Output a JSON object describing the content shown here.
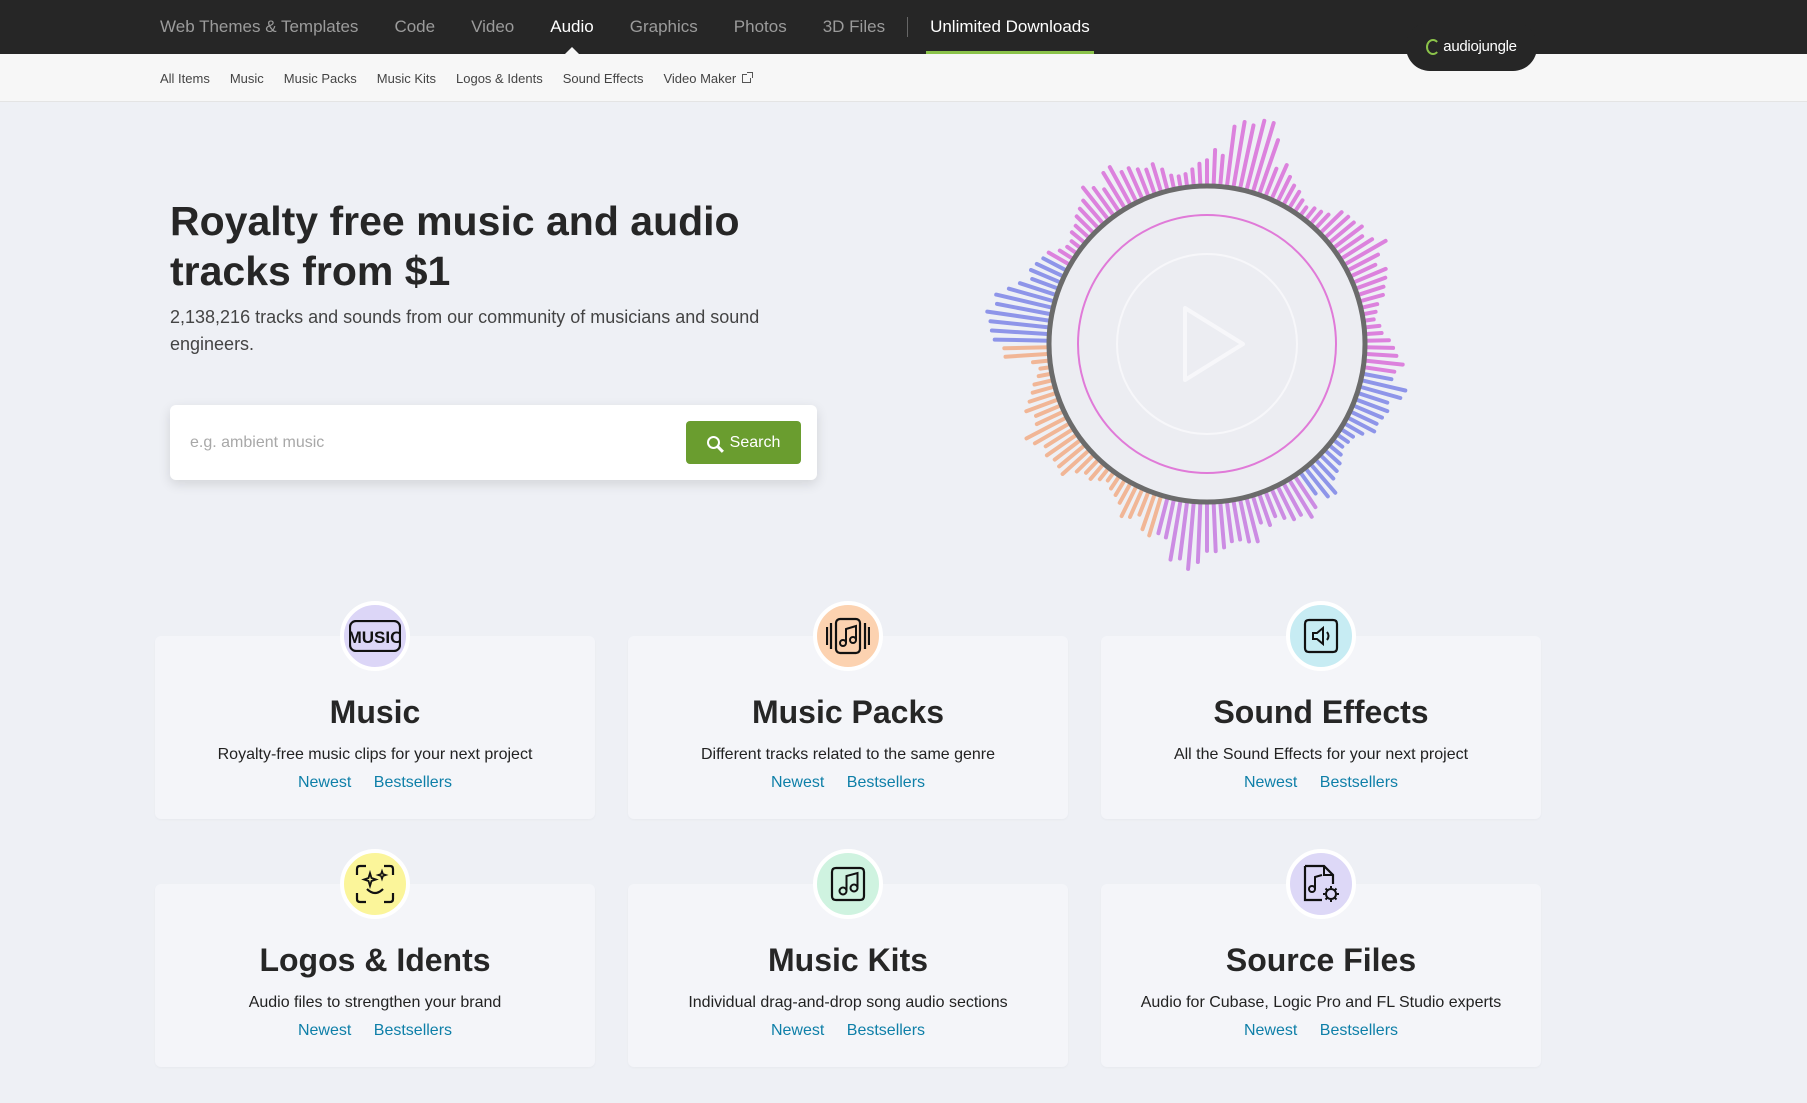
{
  "topnav": {
    "items": [
      {
        "label": "Web Themes & Templates"
      },
      {
        "label": "Code"
      },
      {
        "label": "Video"
      },
      {
        "label": "Audio"
      },
      {
        "label": "Graphics"
      },
      {
        "label": "Photos"
      },
      {
        "label": "3D Files"
      }
    ],
    "unlimited": "Unlimited Downloads",
    "logo": "audiojungle"
  },
  "subnav": {
    "items": [
      {
        "label": "All Items"
      },
      {
        "label": "Music"
      },
      {
        "label": "Music Packs"
      },
      {
        "label": "Music Kits"
      },
      {
        "label": "Logos & Idents"
      },
      {
        "label": "Sound Effects"
      },
      {
        "label": "Video Maker"
      }
    ]
  },
  "hero": {
    "title": "Royalty free music and audio tracks from $1",
    "subtitle": "2,138,216 tracks and sounds from our community of musicians and sound engineers.",
    "search_placeholder": "e.g. ambient music",
    "search_button": "Search"
  },
  "cards": [
    {
      "title": "Music",
      "desc": "Royalty-free music clips for your next project",
      "newest": "Newest",
      "bestsellers": "Bestsellers",
      "icon_bg": "#dcd6f7",
      "icon": "music-text-icon"
    },
    {
      "title": "Music Packs",
      "desc": "Different tracks related to the same genre",
      "newest": "Newest",
      "bestsellers": "Bestsellers",
      "icon_bg": "#fcd2b0",
      "icon": "music-pack-icon"
    },
    {
      "title": "Sound Effects",
      "desc": "All the Sound Effects for your next project",
      "newest": "Newest",
      "bestsellers": "Bestsellers",
      "icon_bg": "#c7ecf3",
      "icon": "speaker-icon"
    },
    {
      "title": "Logos & Idents",
      "desc": "Audio files to strengthen your brand",
      "newest": "Newest",
      "bestsellers": "Bestsellers",
      "icon_bg": "#fbf59a",
      "icon": "sparkle-face-icon"
    },
    {
      "title": "Music Kits",
      "desc": "Individual drag-and-drop song audio sections",
      "newest": "Newest",
      "bestsellers": "Bestsellers",
      "icon_bg": "#cff3e0",
      "icon": "music-note-icon"
    },
    {
      "title": "Source Files",
      "desc": "Audio for Cubase, Logic Pro and FL Studio experts",
      "newest": "Newest",
      "bestsellers": "Bestsellers",
      "icon_bg": "#ddd8f7",
      "icon": "file-gear-icon"
    }
  ],
  "colors": {
    "accent_green": "#6a9d2f",
    "link_blue": "#0e7fa8",
    "nav_bg": "#262626"
  }
}
